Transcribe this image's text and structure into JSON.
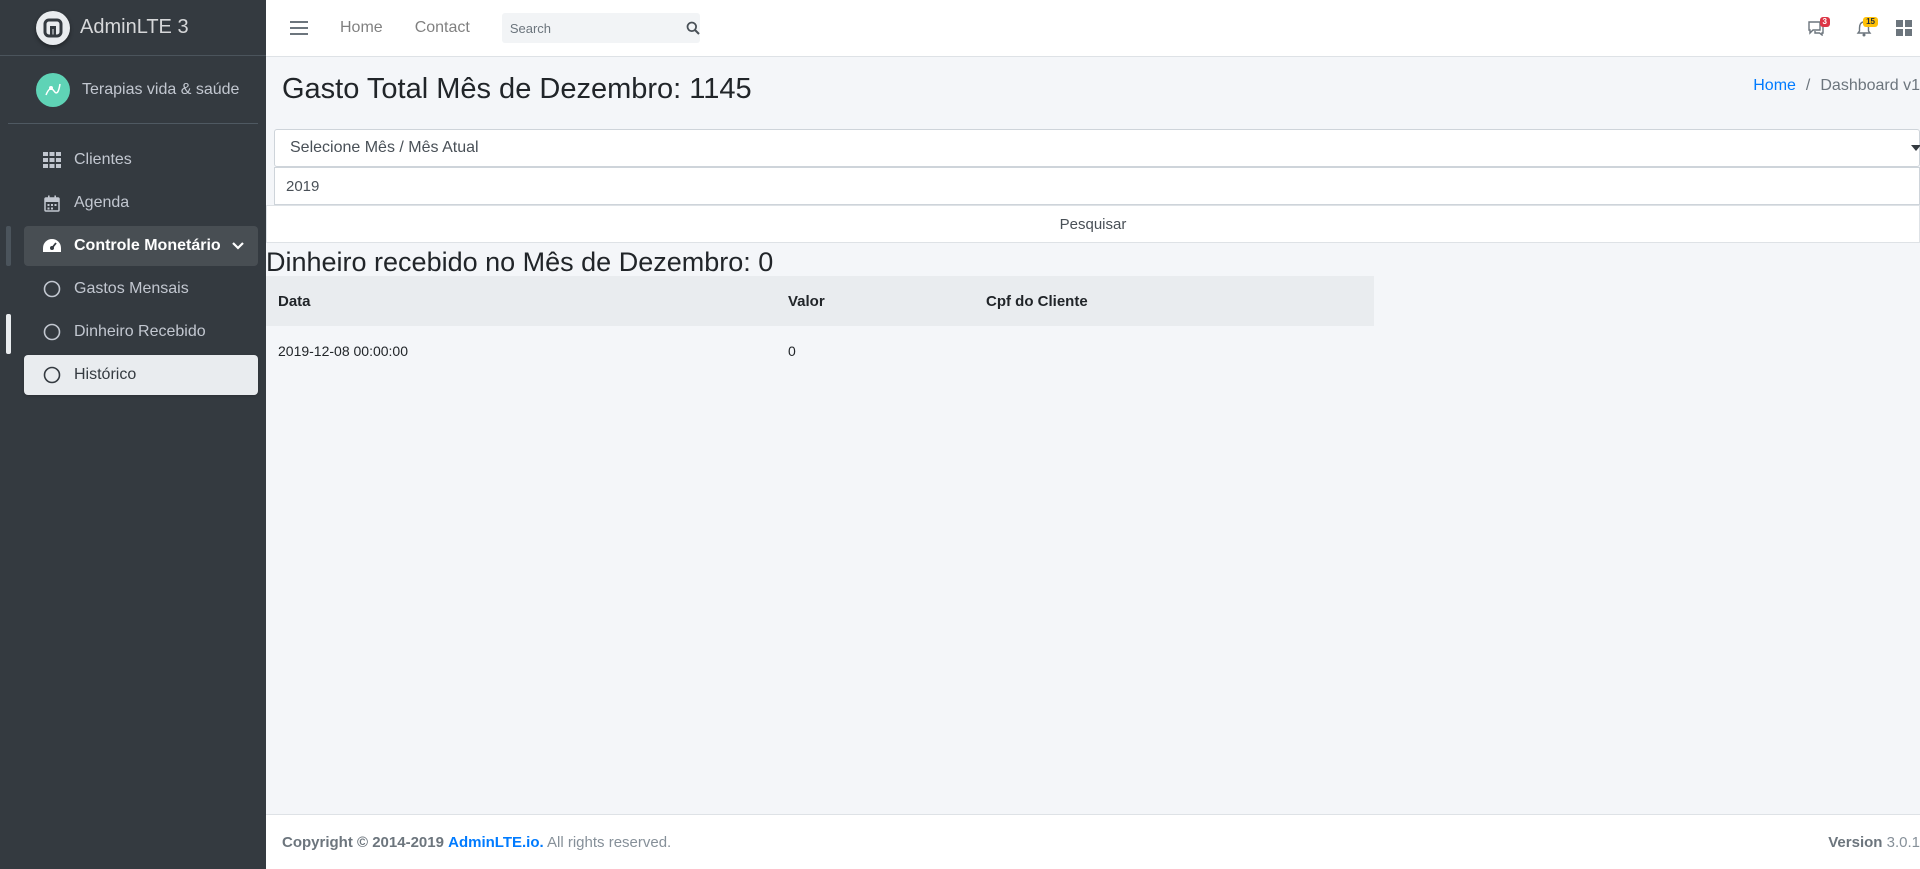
{
  "sidebar": {
    "brand": "AdminLTE 3",
    "user": "Terapias vida & saúde",
    "items": [
      {
        "label": "Clientes"
      },
      {
        "label": "Agenda"
      },
      {
        "label": "Controle Monetário"
      },
      {
        "label": "Gastos Mensais"
      },
      {
        "label": "Dinheiro Recebido"
      },
      {
        "label": "Histórico"
      }
    ]
  },
  "navbar": {
    "links": [
      "Home",
      "Contact"
    ],
    "search_placeholder": "Search",
    "messages_badge": "3",
    "notifications_badge": "15"
  },
  "content": {
    "page_title": "Gasto Total Mês de Dezembro: 1145",
    "breadcrumb": {
      "home": "Home",
      "sep": "/",
      "current": "Dashboard v1"
    },
    "month_select": "Selecione Mês / Mês Atual",
    "year_value": "2019",
    "search_button": "Pesquisar",
    "received_title": "Dinheiro recebido no Mês de Dezembro: 0",
    "table": {
      "headers": [
        "Data",
        "Valor",
        "Cpf do Cliente"
      ],
      "rows": [
        [
          "2019-12-08 00:00:00",
          "0",
          ""
        ]
      ]
    }
  },
  "footer": {
    "copyright": "Copyright © 2014-2019",
    "brand": "AdminLTE.io.",
    "rights": "All rights reserved.",
    "version_label": "Version",
    "version": "3.0.1"
  },
  "colors": {
    "sidebar_bg": "#343a40",
    "accent": "#007bff",
    "badge_red": "#dc3545",
    "badge_yellow": "#ffc107"
  }
}
